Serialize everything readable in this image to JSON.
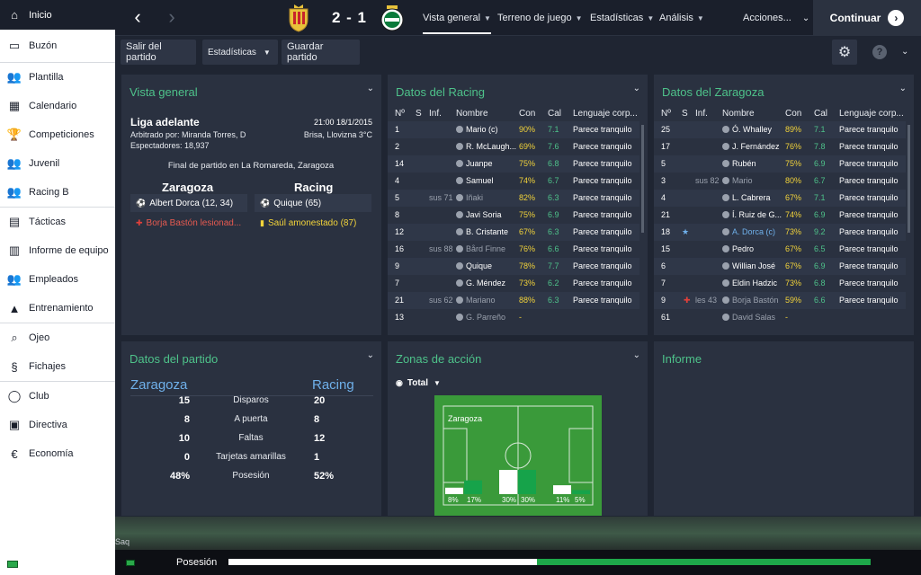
{
  "sidebar": {
    "items": [
      {
        "label": "Inicio",
        "icon": "home-icon",
        "active": true
      },
      {
        "label": "Buzón",
        "icon": "inbox-icon"
      },
      {
        "label": "Plantilla",
        "icon": "squad-icon"
      },
      {
        "label": "Calendario",
        "icon": "calendar-icon"
      },
      {
        "label": "Competiciones",
        "icon": "trophy-icon"
      },
      {
        "label": "Juvenil",
        "icon": "youth-icon"
      },
      {
        "label": "Racing B",
        "icon": "reserve-icon"
      },
      {
        "label": "Tácticas",
        "icon": "tactics-icon"
      },
      {
        "label": "Informe de equipo",
        "icon": "report-icon"
      },
      {
        "label": "Empleados",
        "icon": "staff-icon"
      },
      {
        "label": "Entrenamiento",
        "icon": "training-icon"
      },
      {
        "label": "Ojeo",
        "icon": "search-icon"
      },
      {
        "label": "Fichajes",
        "icon": "transfers-icon"
      },
      {
        "label": "Club",
        "icon": "club-icon"
      },
      {
        "label": "Directiva",
        "icon": "board-icon"
      },
      {
        "label": "Economía",
        "icon": "finance-icon"
      }
    ]
  },
  "header": {
    "score": "2 - 1",
    "tabs": [
      {
        "label": "Vista general",
        "active": true
      },
      {
        "label": "Terreno de juego"
      },
      {
        "label": "Estadísticas"
      },
      {
        "label": "Análisis"
      }
    ],
    "acciones": "Acciones...",
    "continuar": "Continuar"
  },
  "toolbar": {
    "salir": "Salir del partido",
    "estadisticas": "Estadísticas",
    "guardar": "Guardar partido",
    "help": "?"
  },
  "vista": {
    "title": "Vista general",
    "league": "Liga adelante",
    "datetime": "21:00 18/1/2015",
    "referee": "Arbitrado por: Miranda Torres, D",
    "weather": "Brisa, Llovizna 3°C",
    "spectators": "Espectadores: 18,937",
    "final": "Final de partido en La Romareda, Zaragoza",
    "home": "Zaragoza",
    "away": "Racing",
    "home_goal": "Albert Dorca (12, 34)",
    "away_goal": "Quique (65)",
    "home_event": "Borja Bastón lesionad...",
    "away_event": "Saúl amonestado (87)"
  },
  "racing": {
    "title": "Datos del Racing",
    "headers": {
      "n": "Nº",
      "s": "S",
      "inf": "Inf.",
      "nombre": "Nombre",
      "con": "Con",
      "cal": "Cal",
      "lenguaje": "Lenguaje corp..."
    },
    "rows": [
      {
        "n": "1",
        "inf": "",
        "name": "Mario (c)",
        "con": "90%",
        "cal": "7.1",
        "lang": "Parece tranquilo"
      },
      {
        "n": "2",
        "inf": "",
        "name": "R. McLaugh...",
        "con": "69%",
        "cal": "7.6",
        "lang": "Parece tranquilo"
      },
      {
        "n": "14",
        "inf": "",
        "name": "Juanpe",
        "con": "75%",
        "cal": "6.8",
        "lang": "Parece tranquilo"
      },
      {
        "n": "4",
        "inf": "",
        "name": "Samuel",
        "con": "74%",
        "cal": "6.7",
        "lang": "Parece tranquilo"
      },
      {
        "n": "5",
        "inf": "sus 71",
        "name": "Iñaki",
        "con": "82%",
        "cal": "6.3",
        "lang": "Parece tranquilo",
        "dim": true
      },
      {
        "n": "8",
        "inf": "",
        "name": "Javi Soria",
        "con": "75%",
        "cal": "6.9",
        "lang": "Parece tranquilo"
      },
      {
        "n": "12",
        "inf": "",
        "name": "B. Cristante",
        "con": "67%",
        "cal": "6.3",
        "lang": "Parece tranquilo"
      },
      {
        "n": "16",
        "inf": "sus 88",
        "name": "Bård Finne",
        "con": "76%",
        "cal": "6.6",
        "lang": "Parece tranquilo",
        "dim": true
      },
      {
        "n": "9",
        "inf": "",
        "name": "Quique",
        "con": "78%",
        "cal": "7.7",
        "lang": "Parece tranquilo"
      },
      {
        "n": "7",
        "inf": "",
        "name": "G. Méndez",
        "con": "73%",
        "cal": "6.2",
        "lang": "Parece tranquilo"
      },
      {
        "n": "21",
        "inf": "sus 62",
        "name": "Mariano",
        "con": "88%",
        "cal": "6.3",
        "lang": "Parece tranquilo",
        "dim": true
      },
      {
        "n": "13",
        "inf": "",
        "name": "G. Parreño",
        "con": "-",
        "cal": "",
        "lang": "",
        "dim": true
      }
    ]
  },
  "zaragoza": {
    "title": "Datos del Zaragoza",
    "headers": {
      "n": "Nº",
      "s": "S",
      "inf": "Inf.",
      "nombre": "Nombre",
      "con": "Con",
      "cal": "Cal",
      "lenguaje": "Lenguaje corp..."
    },
    "rows": [
      {
        "n": "25",
        "inf": "",
        "name": "Ó. Whalley",
        "con": "89%",
        "cal": "7.1",
        "lang": "Parece tranquilo"
      },
      {
        "n": "17",
        "inf": "",
        "name": "J. Fernández",
        "con": "76%",
        "cal": "7.8",
        "lang": "Parece tranquilo"
      },
      {
        "n": "5",
        "inf": "",
        "name": "Rubén",
        "con": "75%",
        "cal": "6.9",
        "lang": "Parece tranquilo"
      },
      {
        "n": "3",
        "inf": "sus 82",
        "name": "Mario",
        "con": "80%",
        "cal": "6.7",
        "lang": "Parece tranquilo",
        "dim": true
      },
      {
        "n": "4",
        "inf": "",
        "name": "L. Cabrera",
        "con": "67%",
        "cal": "7.1",
        "lang": "Parece tranquilo"
      },
      {
        "n": "21",
        "inf": "",
        "name": "Í. Ruiz de G...",
        "con": "74%",
        "cal": "6.9",
        "lang": "Parece tranquilo"
      },
      {
        "n": "18",
        "inf": "",
        "name": "A. Dorca (c)",
        "con": "73%",
        "cal": "9.2",
        "lang": "Parece tranquilo",
        "star": true,
        "blue": true
      },
      {
        "n": "15",
        "inf": "",
        "name": "Pedro",
        "con": "67%",
        "cal": "6.5",
        "lang": "Parece tranquilo"
      },
      {
        "n": "6",
        "inf": "",
        "name": "Willian José",
        "con": "67%",
        "cal": "6.9",
        "lang": "Parece tranquilo"
      },
      {
        "n": "7",
        "inf": "",
        "name": "Eldin Hadzic",
        "con": "73%",
        "cal": "6.8",
        "lang": "Parece tranquilo"
      },
      {
        "n": "9",
        "inf": "les 43",
        "name": "Borja Bastón",
        "con": "59%",
        "cal": "6.6",
        "lang": "Parece tranquilo",
        "dim": true,
        "injury": true
      },
      {
        "n": "61",
        "inf": "",
        "name": "David Salas",
        "con": "-",
        "cal": "",
        "lang": "",
        "dim": true
      }
    ]
  },
  "partido": {
    "title": "Datos del partido",
    "home": "Zaragoza",
    "away": "Racing",
    "stats": [
      {
        "label": "Disparos",
        "home": "15",
        "away": "20"
      },
      {
        "label": "A puerta",
        "home": "8",
        "away": "8"
      },
      {
        "label": "Faltas",
        "home": "10",
        "away": "12"
      },
      {
        "label": "Tarjetas amarillas",
        "home": "0",
        "away": "1"
      },
      {
        "label": "Posesión",
        "home": "48%",
        "away": "52%"
      }
    ]
  },
  "zonas": {
    "title": "Zonas de acción",
    "filter": "Total",
    "team_label": "Zaragoza",
    "zones": [
      {
        "home": 8,
        "away": 17,
        "home_label": "8%",
        "away_label": "17%"
      },
      {
        "home": 30,
        "away": 30,
        "home_label": "30%",
        "away_label": "30%"
      },
      {
        "home": 11,
        "away": 5,
        "home_label": "11%",
        "away_label": "5%"
      }
    ]
  },
  "informe": {
    "title": "Informe"
  },
  "bottom": {
    "text": "Saq",
    "posesion": "Posesión",
    "posesion_home": 48
  }
}
